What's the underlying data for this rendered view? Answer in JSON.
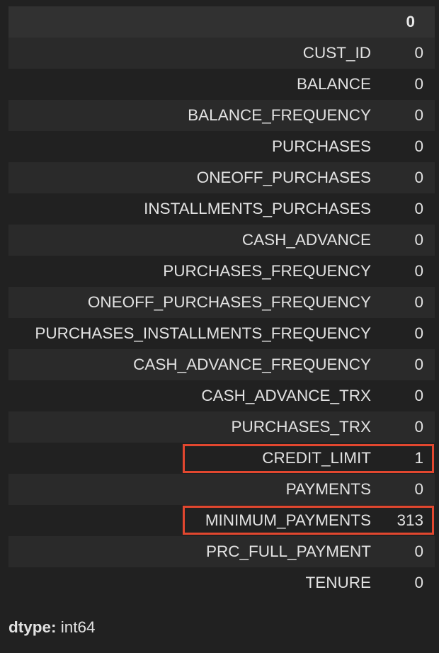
{
  "table": {
    "column_header": "0",
    "rows": [
      {
        "index": "CUST_ID",
        "value": "0"
      },
      {
        "index": "BALANCE",
        "value": "0"
      },
      {
        "index": "BALANCE_FREQUENCY",
        "value": "0"
      },
      {
        "index": "PURCHASES",
        "value": "0"
      },
      {
        "index": "ONEOFF_PURCHASES",
        "value": "0"
      },
      {
        "index": "INSTALLMENTS_PURCHASES",
        "value": "0"
      },
      {
        "index": "CASH_ADVANCE",
        "value": "0"
      },
      {
        "index": "PURCHASES_FREQUENCY",
        "value": "0"
      },
      {
        "index": "ONEOFF_PURCHASES_FREQUENCY",
        "value": "0"
      },
      {
        "index": "PURCHASES_INSTALLMENTS_FREQUENCY",
        "value": "0"
      },
      {
        "index": "CASH_ADVANCE_FREQUENCY",
        "value": "0"
      },
      {
        "index": "CASH_ADVANCE_TRX",
        "value": "0"
      },
      {
        "index": "PURCHASES_TRX",
        "value": "0"
      },
      {
        "index": "CREDIT_LIMIT",
        "value": "1"
      },
      {
        "index": "PAYMENTS",
        "value": "0"
      },
      {
        "index": "MINIMUM_PAYMENTS",
        "value": "313"
      },
      {
        "index": "PRC_FULL_PAYMENT",
        "value": "0"
      },
      {
        "index": "TENURE",
        "value": "0"
      }
    ]
  },
  "dtype": {
    "label": "dtype:",
    "value": "int64"
  },
  "colors": {
    "background": "#212121",
    "header_row": "#313131",
    "striped_row": "#2a2a2a",
    "highlight_border": "#e2472f",
    "text": "#e2e2e2"
  }
}
